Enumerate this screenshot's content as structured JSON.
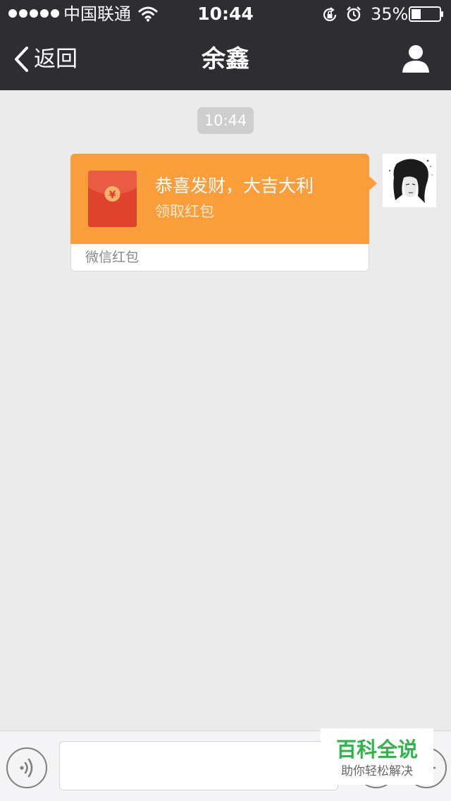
{
  "status_bar": {
    "carrier": "中国联通",
    "time": "10:44",
    "battery_percent": "35%",
    "battery_level": 0.35,
    "signal_bars_filled": 5,
    "icons": [
      "wifi-icon",
      "rotation-lock-icon",
      "alarm-icon",
      "battery-icon"
    ]
  },
  "nav": {
    "back_label": "返回",
    "title": "余鑫",
    "right_icon": "person-icon"
  },
  "chat": {
    "timestamp": "10:44",
    "messages": [
      {
        "type": "red-packet",
        "sender": "self",
        "title": "恭喜发财，大吉大利",
        "subtitle": "领取红包",
        "source_label": "微信红包",
        "icon": "red-envelope-icon"
      }
    ]
  },
  "input_bar": {
    "placeholder": "",
    "value": "",
    "left_icon": "voice-icon",
    "right_icons": [
      "emoji-icon",
      "plus-icon"
    ]
  },
  "watermark": {
    "title": "百科全说",
    "subtitle": "助你轻松解决"
  },
  "colors": {
    "nav_background": "#2e2e32",
    "chat_background": "#ebebeb",
    "red_packet_orange": "#f99e3b",
    "envelope_red": "#e0432d",
    "coin_gold": "#f4b26a",
    "watermark_green": "#2fb54a"
  }
}
